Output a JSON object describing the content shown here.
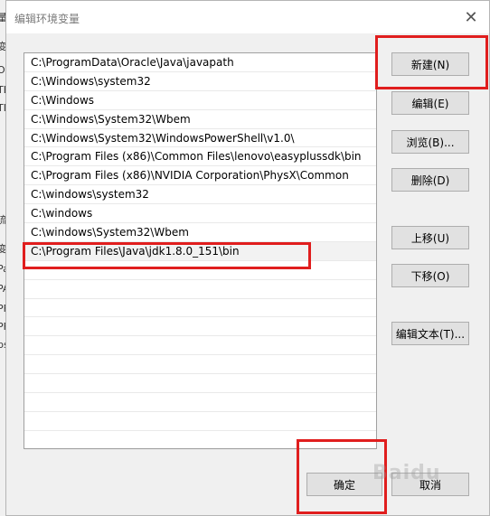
{
  "background_window": {
    "chars": [
      "量",
      "变",
      "O",
      "TE",
      "TN",
      "流",
      "变",
      "Pa",
      "PA",
      "PF",
      "PF",
      "ps"
    ]
  },
  "dialog": {
    "title": "编辑环境变量",
    "close_glyph": "✕"
  },
  "list": {
    "items": [
      "C:\\ProgramData\\Oracle\\Java\\javapath",
      "C:\\Windows\\system32",
      "C:\\Windows",
      "C:\\Windows\\System32\\Wbem",
      "C:\\Windows\\System32\\WindowsPowerShell\\v1.0\\",
      "C:\\Program Files (x86)\\Common Files\\lenovo\\easyplussdk\\bin",
      "C:\\Program Files (x86)\\NVIDIA Corporation\\PhysX\\Common",
      "C:\\windows\\system32",
      "C:\\windows",
      "C:\\windows\\System32\\Wbem",
      "C:\\Program Files\\Java\\jdk1.8.0_151\\bin",
      "",
      "",
      "",
      "",
      "",
      "",
      "",
      "",
      "",
      ""
    ],
    "selected_index": 10
  },
  "buttons": {
    "new": "新建(N)",
    "edit": "编辑(E)",
    "browse": "浏览(B)...",
    "delete": "删除(D)",
    "move_up": "上移(U)",
    "move_down": "下移(O)",
    "edit_text": "编辑文本(T)...",
    "ok": "确定",
    "cancel": "取消"
  },
  "watermark": "Baidu",
  "colors": {
    "annotation": "#e01e1e",
    "button_face": "#e1e1e1",
    "client_bg": "#f0f0f0"
  }
}
